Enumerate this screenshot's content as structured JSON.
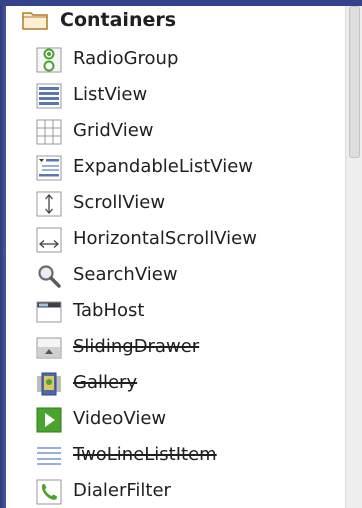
{
  "palette": {
    "frame": "#3b4a8a",
    "panel": "#ffffff",
    "text": "#202020",
    "icon_blue": "#5a78b0",
    "icon_green": "#4aa32f",
    "icon_gray": "#8a8a8a"
  },
  "category": {
    "label": "Containers",
    "icon": "folder-icon"
  },
  "items": [
    {
      "label": "RadioGroup",
      "icon": "radio-group-icon",
      "deprecated": false
    },
    {
      "label": "ListView",
      "icon": "list-view-icon",
      "deprecated": false
    },
    {
      "label": "GridView",
      "icon": "grid-view-icon",
      "deprecated": false
    },
    {
      "label": "ExpandableListView",
      "icon": "expandable-list-icon",
      "deprecated": false
    },
    {
      "label": "ScrollView",
      "icon": "scroll-view-icon",
      "deprecated": false
    },
    {
      "label": "HorizontalScrollView",
      "icon": "horizontal-scroll-icon",
      "deprecated": false
    },
    {
      "label": "SearchView",
      "icon": "search-icon",
      "deprecated": false
    },
    {
      "label": "TabHost",
      "icon": "tab-host-icon",
      "deprecated": false
    },
    {
      "label": "SlidingDrawer",
      "icon": "sliding-drawer-icon",
      "deprecated": true
    },
    {
      "label": "Gallery",
      "icon": "gallery-icon",
      "deprecated": true
    },
    {
      "label": "VideoView",
      "icon": "video-view-icon",
      "deprecated": false
    },
    {
      "label": "TwoLineListItem",
      "icon": "two-line-list-icon",
      "deprecated": true
    },
    {
      "label": "DialerFilter",
      "icon": "dialer-filter-icon",
      "deprecated": false
    }
  ]
}
